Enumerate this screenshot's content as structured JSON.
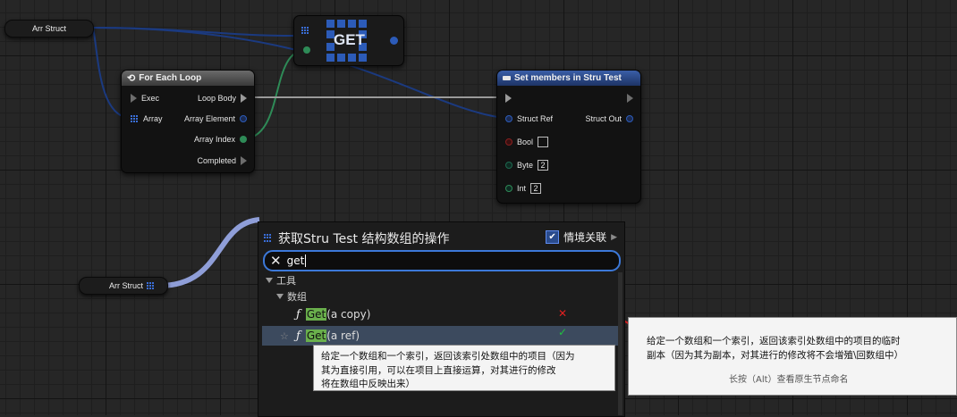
{
  "pills": {
    "arr_struct_top": "Arr Struct",
    "arr_struct_bottom": "Arr Struct"
  },
  "get_node": {
    "label": "GET"
  },
  "foreach": {
    "title": "For Each Loop",
    "exec": "Exec",
    "array": "Array",
    "loop_body": "Loop Body",
    "array_element": "Array Element",
    "array_index": "Array Index",
    "completed": "Completed"
  },
  "setmembers": {
    "title": "Set members in Stru Test",
    "struct_ref": "Struct Ref",
    "struct_out": "Struct Out",
    "bool": "Bool",
    "byte": "Byte",
    "byte_val": "2",
    "int": "Int",
    "int_val": "2"
  },
  "menu": {
    "title": "获取Stru Test 结构数组的操作",
    "context_label": "情境关联",
    "search_value": "get",
    "cat_tools": "工具",
    "cat_array": "数组",
    "items": [
      {
        "match": "Get",
        "rest": " (a copy)"
      },
      {
        "match": "Get",
        "rest": " (a ref)"
      }
    ]
  },
  "tooltip_ref": {
    "line1": "给定一个数组和一个索引，返回该索引处数组中的项目（因为",
    "line2": "其为直接引用，可以在项目上直接运算，对其进行的修改",
    "line3": "将在数组中反映出来）"
  },
  "tooltip_copy": {
    "line1": "给定一个数组和一个索引，返回该索引处数组中的项目的临时",
    "line2": "副本（因为其为副本，对其进行的修改将不会增殖\\回数组中）",
    "footer": "长按（Alt）查看原生节点命名"
  },
  "annotations": {
    "cross": "✕",
    "check": "✓"
  },
  "colors": {
    "accent": "#3c78d8",
    "highlight": "#6ab04c",
    "node_head_foreach": "#4a4a4a",
    "node_head_set": "#2c4a86"
  }
}
